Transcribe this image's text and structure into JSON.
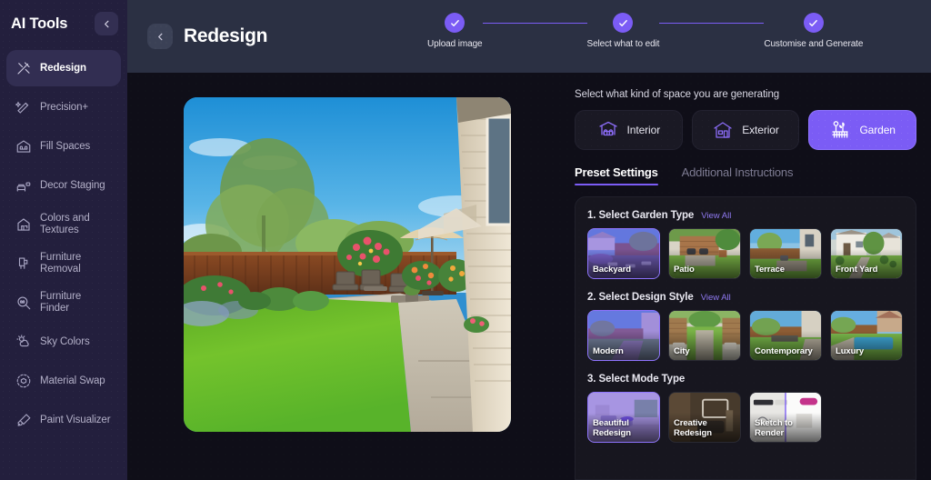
{
  "sidebar": {
    "title": "AI Tools",
    "collapse_icon": "chevron-left-icon",
    "items": [
      {
        "label": "Redesign",
        "icon": "magic-wand-cross-icon",
        "active": true
      },
      {
        "label": "Precision+",
        "icon": "sparkle-pencil-icon",
        "active": false
      },
      {
        "label": "Fill Spaces",
        "icon": "house-sofa-icon",
        "active": false
      },
      {
        "label": "Decor Staging",
        "icon": "furniture-staging-icon",
        "active": false
      },
      {
        "label": "Colors and Textures",
        "icon": "house-swatch-icon",
        "active": false
      },
      {
        "label": "Furniture Removal",
        "icon": "chair-remove-icon",
        "active": false
      },
      {
        "label": "Furniture Finder",
        "icon": "magnifier-sofa-icon",
        "active": false
      },
      {
        "label": "Sky Colors",
        "icon": "sun-cloud-icon",
        "active": false
      },
      {
        "label": "Material Swap",
        "icon": "circular-swap-icon",
        "active": false
      },
      {
        "label": "Paint Visualizer",
        "icon": "paint-roller-icon",
        "active": false
      }
    ]
  },
  "header": {
    "back_icon": "chevron-left-icon",
    "title": "Redesign",
    "steps": [
      {
        "label": "Upload image",
        "complete": true,
        "icon": "check-icon"
      },
      {
        "label": "Select what to edit",
        "complete": true,
        "icon": "check-icon"
      },
      {
        "label": "Customise and Generate",
        "complete": true,
        "icon": "check-icon"
      }
    ]
  },
  "preview": {
    "name": "uploaded-backyard-photo",
    "alt": "Backyard with green lawn, wooden fence, patio furniture and umbrella"
  },
  "settings": {
    "space_heading": "Select what kind of space you are generating",
    "space_types": [
      {
        "label": "Interior",
        "icon": "interior-sofa-icon",
        "selected": false
      },
      {
        "label": "Exterior",
        "icon": "exterior-house-icon",
        "selected": false
      },
      {
        "label": "Garden",
        "icon": "garden-flowers-icon",
        "selected": true
      }
    ],
    "tabs": [
      {
        "label": "Preset Settings",
        "active": true
      },
      {
        "label": "Additional Instructions",
        "active": false
      }
    ],
    "view_all_label": "View All",
    "groups": [
      {
        "title": "1. Select Garden Type",
        "has_view_all": true,
        "options": [
          {
            "label": "Backyard",
            "selected": true
          },
          {
            "label": "Patio",
            "selected": false
          },
          {
            "label": "Terrace",
            "selected": false
          },
          {
            "label": "Front Yard",
            "selected": false
          }
        ]
      },
      {
        "title": "2. Select Design Style",
        "has_view_all": true,
        "options": [
          {
            "label": "Modern",
            "selected": true
          },
          {
            "label": "City",
            "selected": false
          },
          {
            "label": "Contemporary",
            "selected": false
          },
          {
            "label": "Luxury",
            "selected": false
          }
        ]
      },
      {
        "title": "3. Select Mode Type",
        "has_view_all": false,
        "options": [
          {
            "label": "Beautiful Redesign",
            "selected": true
          },
          {
            "label": "Creative Redesign",
            "selected": false
          },
          {
            "label": "Sketch to Render",
            "selected": false
          }
        ]
      }
    ]
  },
  "colors": {
    "accent": "#7b5cf5",
    "sidebar_bg": "#231f3d",
    "topbar_bg": "#2b3043",
    "body_bg": "#0f0e18",
    "card_bg": "#17161f"
  }
}
